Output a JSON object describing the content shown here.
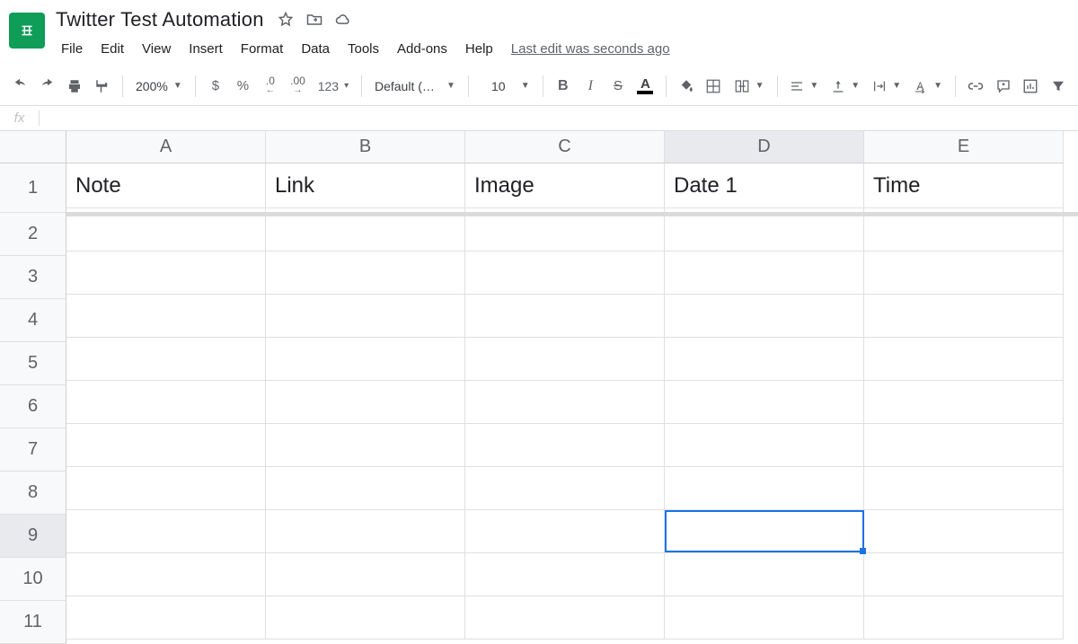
{
  "doc": {
    "title": "Twitter Test Automation"
  },
  "menus": {
    "file": "File",
    "edit": "Edit",
    "view": "View",
    "insert": "Insert",
    "format": "Format",
    "data": "Data",
    "tools": "Tools",
    "addons": "Add-ons",
    "help": "Help",
    "last_edit": "Last edit was seconds ago"
  },
  "toolbar": {
    "zoom": "200%",
    "currency": "$",
    "percent": "%",
    "dec_dec": ".0",
    "dec_inc": ".00",
    "num_fmt": "123",
    "font": "Default (Ari…",
    "font_size": "10"
  },
  "fx": {
    "label": "fx",
    "value": ""
  },
  "columns": [
    "A",
    "B",
    "C",
    "D",
    "E"
  ],
  "rows": [
    "1",
    "2",
    "3",
    "4",
    "5",
    "6",
    "7",
    "8",
    "9",
    "10",
    "11"
  ],
  "headers": {
    "A": "Note",
    "B": "Link",
    "C": "Image",
    "D": "Date 1",
    "E": "Time"
  },
  "selection": {
    "col": "D",
    "row": "9"
  }
}
